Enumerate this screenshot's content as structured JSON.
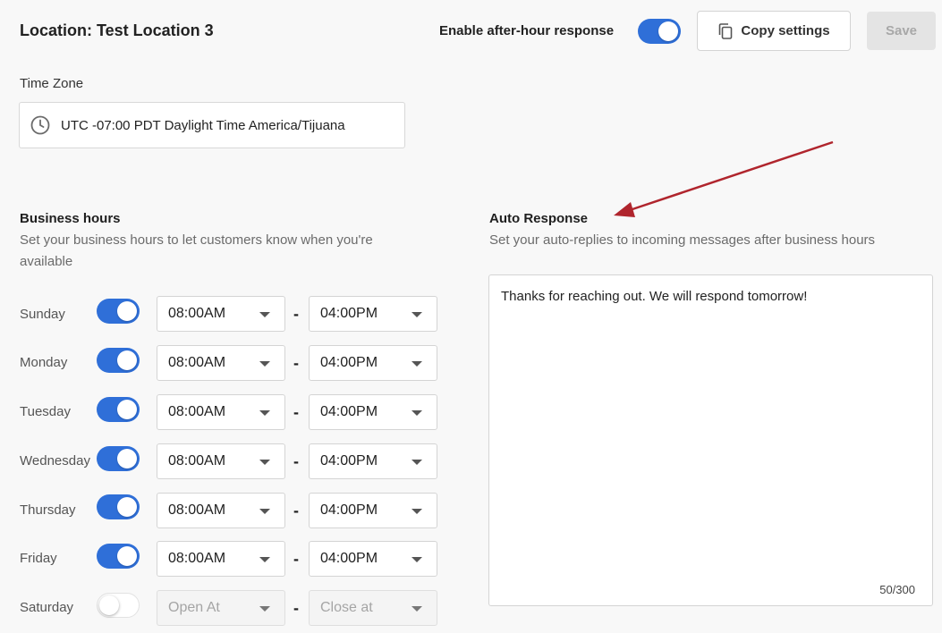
{
  "header": {
    "title": "Location: Test Location 3",
    "after_hour_label": "Enable after-hour response",
    "after_hour_enabled": true,
    "copy_label": "Copy settings",
    "save_label": "Save"
  },
  "timezone": {
    "label": "Time Zone",
    "value": "UTC -07:00 PDT Daylight Time America/Tijuana"
  },
  "business_hours": {
    "title": "Business hours",
    "description_line1": "Set your business hours to let customers know when you're",
    "description_line2": "available",
    "days": [
      {
        "name": "Sunday",
        "enabled": true,
        "open": "08:00AM",
        "close": "04:00PM"
      },
      {
        "name": "Monday",
        "enabled": true,
        "open": "08:00AM",
        "close": "04:00PM"
      },
      {
        "name": "Tuesday",
        "enabled": true,
        "open": "08:00AM",
        "close": "04:00PM"
      },
      {
        "name": "Wednesday",
        "enabled": true,
        "open": "08:00AM",
        "close": "04:00PM"
      },
      {
        "name": "Thursday",
        "enabled": true,
        "open": "08:00AM",
        "close": "04:00PM"
      },
      {
        "name": "Friday",
        "enabled": true,
        "open": "08:00AM",
        "close": "04:00PM"
      },
      {
        "name": "Saturday",
        "enabled": false,
        "open": "Open At",
        "close": "Close at"
      }
    ],
    "separator": "-"
  },
  "auto_response": {
    "title": "Auto Response",
    "description": "Set your auto-replies to incoming messages after business hours",
    "message": "Thanks for reaching out. We will respond tomorrow!",
    "char_count": "50/300"
  },
  "colors": {
    "accent": "#2f6fd8",
    "annotation_arrow": "#b0252d"
  },
  "icons": {
    "timezone": "clock-icon",
    "copy": "copy-icon"
  }
}
